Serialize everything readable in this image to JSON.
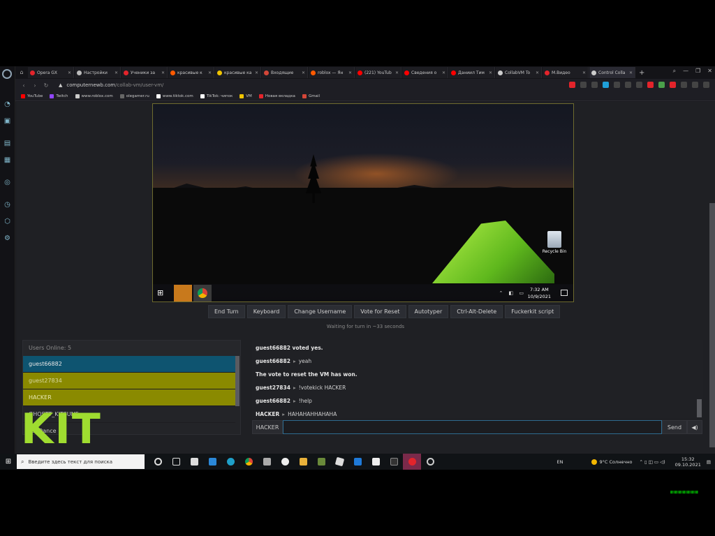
{
  "browser": {
    "tabs": [
      {
        "label": "Opera GX",
        "color": "#e3242b"
      },
      {
        "label": "Настройки",
        "color": "#bbbbbb"
      },
      {
        "label": "Ученики за",
        "color": "#e3242b"
      },
      {
        "label": "красивые к",
        "color": "#ff5a00"
      },
      {
        "label": "красивые ка",
        "color": "#f0c400"
      },
      {
        "label": "Входящие",
        "color": "#d44638"
      },
      {
        "label": "roblox — Ян",
        "color": "#ff5a00"
      },
      {
        "label": "(221) YouTub",
        "color": "#ff0000"
      },
      {
        "label": "Сведения о",
        "color": "#ff0000"
      },
      {
        "label": "Даниил Тим",
        "color": "#ff0000"
      },
      {
        "label": "CollabVM To",
        "color": "#cccccc"
      },
      {
        "label": "M.Видео",
        "color": "#e3242b"
      },
      {
        "label": "Control Colla",
        "color": "#cccccc"
      }
    ],
    "url_host": "computernewb.com",
    "url_path": "/collab-vm/user-vm/",
    "bookmarks": [
      {
        "label": "YouTube",
        "color": "#ff0000"
      },
      {
        "label": "Twitch",
        "color": "#9146ff"
      },
      {
        "label": "www.roblox.com",
        "color": "#cccccc"
      },
      {
        "label": "olegamer.ru",
        "color": "#666666"
      },
      {
        "label": "www.tiktok.com",
        "color": "#ffffff"
      },
      {
        "label": "TikTok: чипок",
        "color": "#ffffff"
      },
      {
        "label": "VM",
        "color": "#f0c400"
      },
      {
        "label": "Новая вкладка",
        "color": "#e3242b"
      },
      {
        "label": "Gmail",
        "color": "#d44638"
      }
    ]
  },
  "vm": {
    "recycle_bin": "Recycle Bin",
    "clock_time": "7:32 AM",
    "clock_date": "10/9/2021"
  },
  "controls": {
    "end_turn": "End Turn",
    "keyboard": "Keyboard",
    "change_username": "Change Username",
    "vote_reset": "Vote for Reset",
    "autotyper": "Autotyper",
    "ctrl_alt_del": "Ctrl-Alt-Delete",
    "script": "Fuckerkit script"
  },
  "waiting_text": "Waiting for turn in ~33 seconds",
  "users": {
    "header": "Users Online: 5",
    "list": [
      {
        "name": "guest66882",
        "bg": "#0e5470",
        "fg": "#e6e6e6"
      },
      {
        "name": "guest27834",
        "bg": "#8a8a00",
        "fg": "#d8d8a0"
      },
      {
        "name": "HACKER",
        "bg": "#8a8a00",
        "fg": "#e8e8b0"
      },
      {
        "name": "GHOSTT_KITSUNE",
        "bg": "#232428",
        "fg": "#c8c8c8"
      },
      {
        "name": "cal Dance",
        "bg": "#232428",
        "fg": "#c8c8c8"
      }
    ]
  },
  "chat": {
    "messages": [
      {
        "user": "guest66882 voted yes.",
        "text": ""
      },
      {
        "user": "guest66882",
        "text": "yeah"
      },
      {
        "user": "The vote to reset the VM has won.",
        "text": ""
      },
      {
        "user": "guest27834",
        "text": "!votekick HACKER"
      },
      {
        "user": "guest66882",
        "text": "!help"
      },
      {
        "user": "HACKER",
        "text": "HAHAHAHHAHAHA"
      }
    ],
    "input_name": "HACKER",
    "input_value": "",
    "send": "Send",
    "audio": "◀)"
  },
  "watermark": "KIT",
  "taskbar": {
    "search_placeholder": "Введите здесь текст для поиска",
    "lang": "EN",
    "weather": "9°C  Солнечно",
    "time": "15:32",
    "date": "09.10.2021"
  }
}
